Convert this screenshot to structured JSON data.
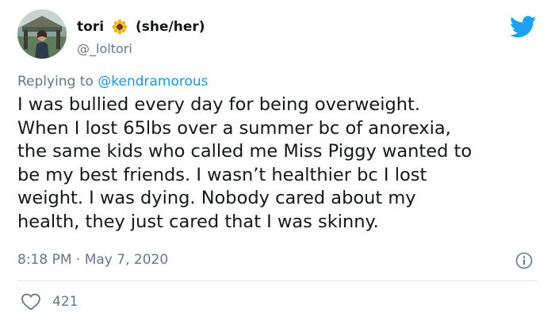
{
  "author": {
    "display_name": "tori",
    "pronouns": "(she/her)",
    "handle": "@_loltori"
  },
  "reply": {
    "prefix": "Replying to ",
    "mention": "@kendramorous"
  },
  "tweet": {
    "text": "I was bullied every day for being overweight.\nWhen I lost 65lbs over a summer bc of anorexia,\nthe same kids who called me Miss Piggy wanted to\nbe my best friends. I wasn’t healthier bc I lost\nweight. I was dying. Nobody cared about my\nhealth, they just cared that I was skinny.",
    "timestamp": "8:18 PM · May 7, 2020",
    "like_count": "421"
  },
  "icons": {
    "avatar": "avatar-photo",
    "flower": "sunflower-icon",
    "brand": "twitter-bird-icon",
    "info": "info-icon",
    "like": "heart-icon"
  },
  "colors": {
    "text": "#14171a",
    "secondary": "#657786",
    "link": "#1b95e0",
    "brand": "#1da1f2",
    "divider": "#e1e8ed"
  }
}
